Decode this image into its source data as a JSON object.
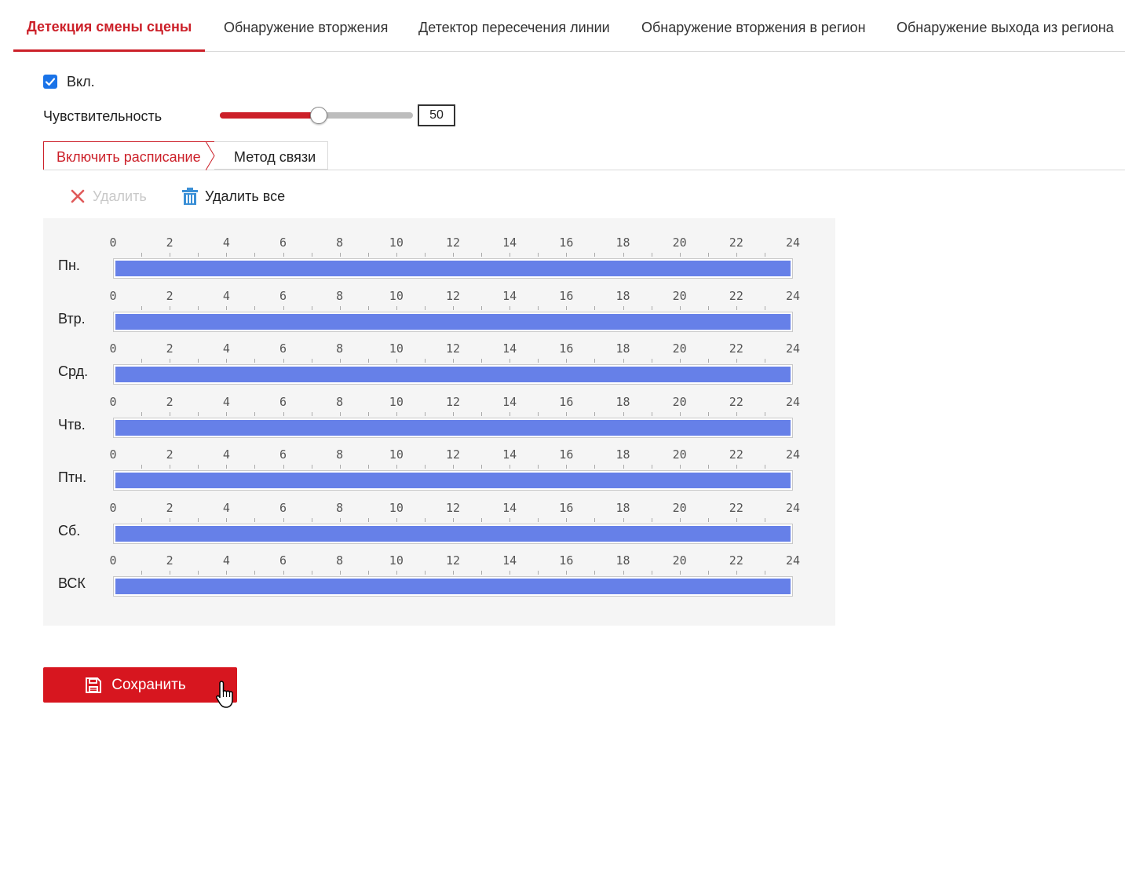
{
  "top_tabs": [
    {
      "label": "Детекция смены сцены",
      "active": true
    },
    {
      "label": "Обнаружение вторжения",
      "active": false
    },
    {
      "label": "Детектор пересечения линии",
      "active": false
    },
    {
      "label": "Обнаружение вторжения в регион",
      "active": false
    },
    {
      "label": "Обнаружение выхода из региона",
      "active": false
    }
  ],
  "enable": {
    "label": "Вкл.",
    "checked": true
  },
  "sensitivity": {
    "label": "Чувствительность",
    "value": "50",
    "min": 0,
    "max": 100
  },
  "sub_tabs": {
    "schedule": "Включить расписание",
    "linkage": "Метод связи"
  },
  "toolbar": {
    "delete_label": "Удалить",
    "delete_all_label": "Удалить все"
  },
  "schedule": {
    "ticks": [
      "0",
      "2",
      "4",
      "6",
      "8",
      "10",
      "12",
      "14",
      "16",
      "18",
      "20",
      "22",
      "24"
    ],
    "days": [
      {
        "label": "Пн.",
        "start": 0,
        "end": 24
      },
      {
        "label": "Втр.",
        "start": 0,
        "end": 24
      },
      {
        "label": "Срд.",
        "start": 0,
        "end": 24
      },
      {
        "label": "Чтв.",
        "start": 0,
        "end": 24
      },
      {
        "label": "Птн.",
        "start": 0,
        "end": 24
      },
      {
        "label": "Сб.",
        "start": 0,
        "end": 24
      },
      {
        "label": "ВСК",
        "start": 0,
        "end": 24
      }
    ]
  },
  "save_button": {
    "label": "Сохранить"
  },
  "colors": {
    "accent": "#cc2029",
    "schedule_bar": "#6680e8",
    "checkbox": "#1a73e8",
    "save_button": "#d7161f"
  }
}
